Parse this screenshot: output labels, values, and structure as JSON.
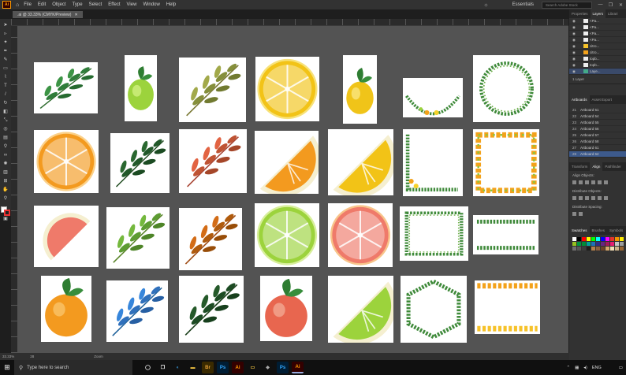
{
  "app": {
    "logo": "Ai",
    "menu": [
      "File",
      "Edit",
      "Object",
      "Type",
      "Select",
      "Effect",
      "View",
      "Window",
      "Help"
    ],
    "search_placeholder": "Search Adobe Stock",
    "workspace": "Essentials",
    "window_controls": [
      "—",
      "❐",
      "✕"
    ]
  },
  "document": {
    "tab_label": ".ai @ 33.33% (CMYK/Preview)",
    "close": "✕"
  },
  "status": {
    "zoom": "33.33%",
    "artboard_number": "28",
    "mode": "Zoom"
  },
  "panels": {
    "top_tabs": [
      "Properties",
      "Layers",
      "Librari"
    ],
    "active_top_tab": "Layers",
    "layers": [
      {
        "name": "<Pa..."
      },
      {
        "name": "<Pa..."
      },
      {
        "name": "<Pa..."
      },
      {
        "name": "<Pa..."
      },
      {
        "name": "citro..."
      },
      {
        "name": "citro..."
      },
      {
        "name": "topb..."
      },
      {
        "name": "topb..."
      },
      {
        "name": "Laye..."
      }
    ],
    "layers_footer": "1 Layer",
    "artboard_tabs": [
      "Artboards",
      "Asset Export"
    ],
    "artboards": [
      {
        "n": "21",
        "name": "Artboard 51"
      },
      {
        "n": "22",
        "name": "Artboard 54"
      },
      {
        "n": "23",
        "name": "Artboard 55"
      },
      {
        "n": "24",
        "name": "Artboard 56"
      },
      {
        "n": "25",
        "name": "Artboard 57"
      },
      {
        "n": "26",
        "name": "Artboard 58"
      },
      {
        "n": "27",
        "name": "Artboard 61"
      },
      {
        "n": "28",
        "name": "Artboard 62"
      }
    ],
    "align_tabs": [
      "Transform",
      "Align",
      "Pathfinder"
    ],
    "align_objects": "Align Objects:",
    "distribute_objects": "Distribute Objects:",
    "distribute_spacing": "Distribute Spacing:",
    "swatch_tabs": [
      "Swatches",
      "Brushes",
      "Symbols"
    ]
  },
  "taskbar": {
    "search_placeholder": "Type here to search",
    "apps": [
      "Ps",
      "Ai",
      "Ps",
      "Ai"
    ],
    "language": "ENG"
  },
  "colors": {
    "canvas": "#535353",
    "accent": "#3d5a8c",
    "ai_orange": "#ff9a00"
  }
}
